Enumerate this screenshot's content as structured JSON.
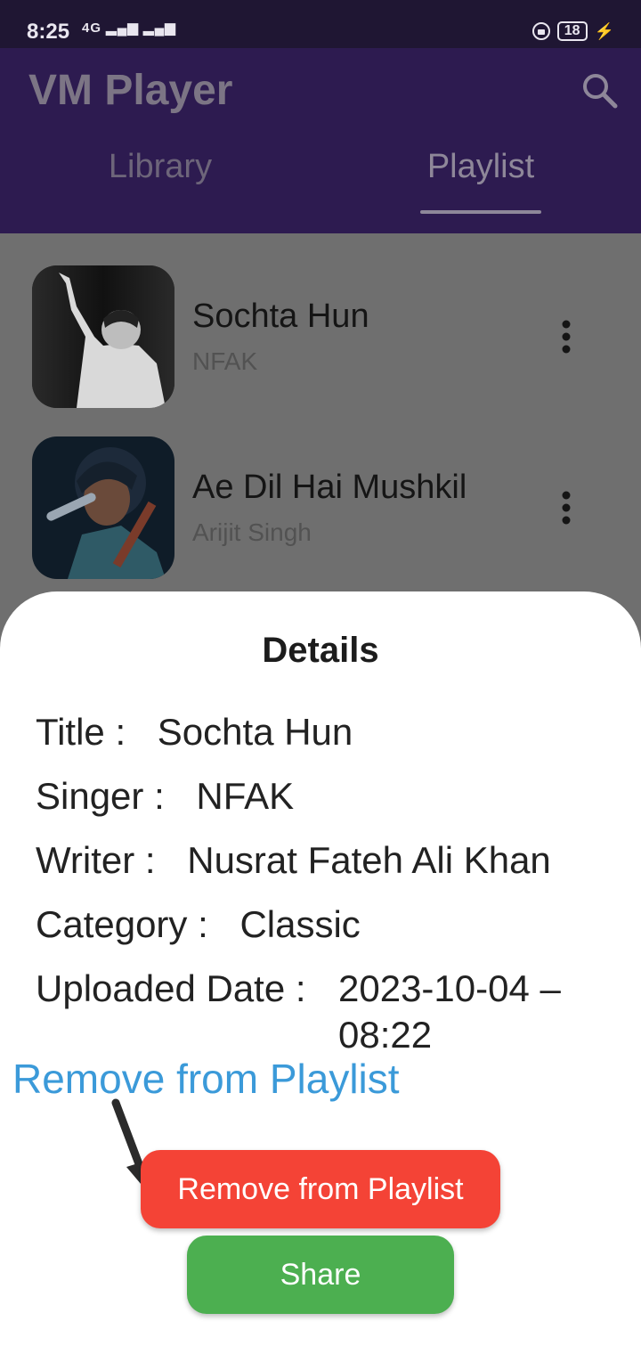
{
  "status_bar": {
    "time": "8:25",
    "network": "4G",
    "battery": "18"
  },
  "app_bar": {
    "title": "VM Player",
    "search_icon": "search-icon",
    "tabs": [
      {
        "label": "Library",
        "active": false
      },
      {
        "label": "Playlist",
        "active": true
      }
    ]
  },
  "songs": [
    {
      "title": "Sochta Hun",
      "artist": "NFAK",
      "thumb": "singer-portrait-bw",
      "menu_icon": "more-vert-icon"
    },
    {
      "title": "Ae Dil Hai Mushkil",
      "artist": "Arijit Singh",
      "thumb": "singer-portrait-color",
      "menu_icon": "more-vert-icon"
    }
  ],
  "details": {
    "heading": "Details",
    "title_label": "Title :",
    "title_value": "Sochta Hun",
    "singer_label": "Singer :",
    "singer_value": "NFAK",
    "writer_label": "Writer :",
    "writer_value": "Nusrat Fateh Ali Khan",
    "category_label": "Category :",
    "category_value": "Classic",
    "date_label": "Uploaded Date :",
    "date_value": "2023-10-04 – 08:22"
  },
  "annotation": {
    "text": "Remove from Playlist",
    "color": "#3b9ad9"
  },
  "actions": {
    "remove_label": "Remove from Playlist",
    "remove_color": "#f44336",
    "share_label": "Share",
    "share_color": "#4caf50"
  }
}
